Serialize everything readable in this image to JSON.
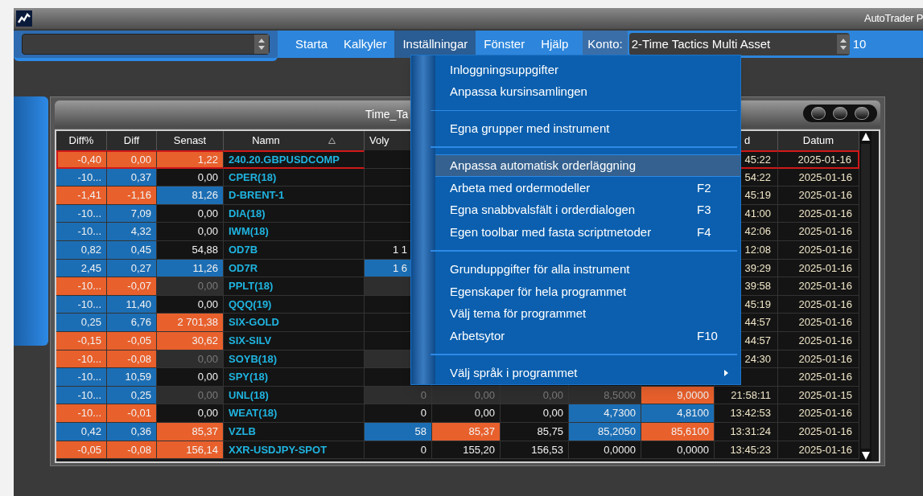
{
  "window": {
    "title": "AutoTrader P"
  },
  "toolbar": {
    "menus": [
      {
        "label": "Starta",
        "selected": false
      },
      {
        "label": "Kalkyler",
        "selected": false
      },
      {
        "label": "Inställningar",
        "selected": true
      },
      {
        "label": "Fönster",
        "selected": false
      },
      {
        "label": "Hjälp",
        "selected": false
      }
    ],
    "account_label": "Konto:",
    "account_value": "2-Time Tactics Multi Asset",
    "column_3": "10"
  },
  "panel": {
    "title": "Time_Ta",
    "table": {
      "columns": [
        {
          "label": "Diff%"
        },
        {
          "label": "Diff"
        },
        {
          "label": "Senast"
        },
        {
          "label": "Namn",
          "sorted": true
        },
        {
          "label": "Voly"
        },
        null,
        null,
        null,
        null,
        {
          "label": "d"
        },
        {
          "label": "Datum"
        }
      ],
      "rows": [
        {
          "selected": true,
          "cells": [
            {
              "text": "-0,40",
              "color": "#e8602c"
            },
            {
              "text": "0,00",
              "color": "#e8602c"
            },
            {
              "text": "1,22",
              "color": "#e8602c"
            },
            {
              "text": "240.20.GBPUSDCOMP"
            },
            null,
            null,
            null,
            null,
            null,
            {
              "text": "45:22"
            },
            {
              "text": "2025-01-16"
            }
          ]
        },
        {
          "selected": false,
          "cells": [
            {
              "text": "-10...",
              "color": "#1c6eb4"
            },
            {
              "text": "0,37",
              "color": "#1c6eb4"
            },
            {
              "text": "0,00"
            },
            {
              "text": "CPER(18)"
            },
            null,
            null,
            null,
            null,
            null,
            {
              "text": "54:22"
            },
            {
              "text": "2025-01-16"
            }
          ]
        },
        {
          "selected": false,
          "cells": [
            {
              "text": "-1,41",
              "color": "#e8602c"
            },
            {
              "text": "-1,16",
              "color": "#e8602c"
            },
            {
              "text": "81,26",
              "color": "#1c6eb4"
            },
            {
              "text": "D-BRENT-1"
            },
            null,
            null,
            null,
            null,
            null,
            {
              "text": "45:19"
            },
            {
              "text": "2025-01-16"
            }
          ]
        },
        {
          "selected": false,
          "cells": [
            {
              "text": "-10...",
              "color": "#1c6eb4"
            },
            {
              "text": "7,09",
              "color": "#1c6eb4"
            },
            {
              "text": "0,00"
            },
            {
              "text": "DIA(18)"
            },
            null,
            null,
            null,
            null,
            null,
            {
              "text": "41:00"
            },
            {
              "text": "2025-01-16"
            }
          ]
        },
        {
          "selected": false,
          "cells": [
            {
              "text": "-10...",
              "color": "#1c6eb4"
            },
            {
              "text": "4,32",
              "color": "#1c6eb4"
            },
            {
              "text": "0,00"
            },
            {
              "text": "IWM(18)"
            },
            null,
            null,
            null,
            null,
            null,
            {
              "text": "42:06"
            },
            {
              "text": "2025-01-16"
            }
          ]
        },
        {
          "selected": false,
          "cells": [
            {
              "text": "0,82",
              "color": "#1c6eb4"
            },
            {
              "text": "0,45",
              "color": "#1c6eb4"
            },
            {
              "text": "54,88"
            },
            {
              "text": "OD7B"
            },
            {
              "text": "1 1"
            },
            null,
            null,
            null,
            null,
            {
              "text": "12:08"
            },
            {
              "text": "2025-01-16"
            }
          ]
        },
        {
          "selected": false,
          "cells": [
            {
              "text": "2,45",
              "color": "#1c6eb4"
            },
            {
              "text": "0,27",
              "color": "#1c6eb4"
            },
            {
              "text": "11,26",
              "color": "#1c6eb4"
            },
            {
              "text": "OD7R"
            },
            {
              "text": "1 6",
              "color": "#1c6eb4"
            },
            null,
            null,
            null,
            null,
            {
              "text": "39:29"
            },
            {
              "text": "2025-01-16"
            }
          ]
        },
        {
          "selected": false,
          "cells": [
            {
              "text": "-10...",
              "color": "#e8602c"
            },
            {
              "text": "-0,07",
              "color": "#e8602c"
            },
            {
              "text": "0,00",
              "color": "#2e2e2e"
            },
            {
              "text": "PPLT(18)"
            },
            {
              "color": "#2e2e2e"
            },
            null,
            null,
            null,
            null,
            {
              "text": "39:58"
            },
            {
              "text": "2025-01-16"
            }
          ]
        },
        {
          "selected": false,
          "cells": [
            {
              "text": "-10...",
              "color": "#1c6eb4"
            },
            {
              "text": "11,40",
              "color": "#1c6eb4"
            },
            {
              "text": "0,00"
            },
            {
              "text": "QQQ(19)"
            },
            null,
            null,
            null,
            null,
            null,
            {
              "text": "45:19"
            },
            {
              "text": "2025-01-16"
            }
          ]
        },
        {
          "selected": false,
          "cells": [
            {
              "text": "0,25",
              "color": "#1c6eb4"
            },
            {
              "text": "6,76",
              "color": "#1c6eb4"
            },
            {
              "text": "2 701,38",
              "color": "#e8602c"
            },
            {
              "text": "SIX-GOLD"
            },
            null,
            null,
            null,
            null,
            null,
            {
              "text": "44:57"
            },
            {
              "text": "2025-01-16"
            }
          ]
        },
        {
          "selected": false,
          "cells": [
            {
              "text": "-0,15",
              "color": "#e8602c"
            },
            {
              "text": "-0,05",
              "color": "#e8602c"
            },
            {
              "text": "30,62",
              "color": "#e8602c"
            },
            {
              "text": "SIX-SILV"
            },
            null,
            null,
            null,
            null,
            null,
            {
              "text": "44:57"
            },
            {
              "text": "2025-01-16"
            }
          ]
        },
        {
          "selected": false,
          "cells": [
            {
              "text": "-10...",
              "color": "#e8602c"
            },
            {
              "text": "-0,08",
              "color": "#e8602c"
            },
            {
              "text": "0,00",
              "color": "#2e2e2e"
            },
            {
              "text": "SOYB(18)"
            },
            {
              "color": "#2e2e2e"
            },
            null,
            null,
            null,
            null,
            {
              "text": "24:30"
            },
            {
              "text": "2025-01-16"
            }
          ]
        },
        {
          "selected": false,
          "cells": [
            {
              "text": "-10...",
              "color": "#1c6eb4"
            },
            {
              "text": "10,59",
              "color": "#1c6eb4"
            },
            {
              "text": "0,00"
            },
            {
              "text": "SPY(18)"
            },
            null,
            null,
            null,
            null,
            null,
            null,
            {
              "text": "2025-01-16"
            }
          ]
        },
        {
          "selected": false,
          "cells": [
            {
              "text": "-10...",
              "color": "#1c6eb4"
            },
            {
              "text": "0,25",
              "color": "#1c6eb4"
            },
            {
              "text": "0,00",
              "color": "#2e2e2e"
            },
            {
              "text": "UNL(18)"
            },
            {
              "text": "0",
              "color": "#2e2e2e"
            },
            {
              "text": "0,00",
              "color": "#2e2e2e"
            },
            {
              "text": "0,00",
              "color": "#2e2e2e"
            },
            {
              "text": "8,5000",
              "color": "#2e2e2e"
            },
            {
              "text": "9,0000",
              "color": "#e8602c"
            },
            {
              "text": "21:58:11"
            },
            {
              "text": "2025-01-15"
            }
          ]
        },
        {
          "selected": false,
          "cells": [
            {
              "text": "-10...",
              "color": "#e8602c"
            },
            {
              "text": "-0,01",
              "color": "#e8602c"
            },
            {
              "text": "0,00"
            },
            {
              "text": "WEAT(18)"
            },
            {
              "text": "0"
            },
            {
              "text": "0,00"
            },
            {
              "text": "0,00"
            },
            {
              "text": "4,7300",
              "color": "#1c6eb4"
            },
            {
              "text": "4,8100",
              "color": "#1c6eb4"
            },
            {
              "text": "13:42:53"
            },
            {
              "text": "2025-01-16"
            }
          ]
        },
        {
          "selected": false,
          "cells": [
            {
              "text": "0,42",
              "color": "#1c6eb4"
            },
            {
              "text": "0,36",
              "color": "#1c6eb4"
            },
            {
              "text": "85,37",
              "color": "#e8602c"
            },
            {
              "text": "VZLB"
            },
            {
              "text": "58",
              "color": "#1c6eb4"
            },
            {
              "text": "85,37",
              "color": "#e8602c"
            },
            {
              "text": "85,75"
            },
            {
              "text": "85,2050",
              "color": "#1c6eb4"
            },
            {
              "text": "85,6100",
              "color": "#e8602c"
            },
            {
              "text": "13:31:24"
            },
            {
              "text": "2025-01-16"
            }
          ]
        },
        {
          "selected": false,
          "cells": [
            {
              "text": "-0,05",
              "color": "#e8602c"
            },
            {
              "text": "-0,08",
              "color": "#e8602c"
            },
            {
              "text": "156,14",
              "color": "#e8602c"
            },
            {
              "text": "XXR-USDJPY-SPOT"
            },
            {
              "text": "0"
            },
            {
              "text": "155,20"
            },
            {
              "text": "156,53"
            },
            {
              "text": "0,0000"
            },
            {
              "text": "0,0000"
            },
            {
              "text": "13:45:23"
            },
            {
              "text": "2025-01-16"
            }
          ]
        }
      ]
    }
  },
  "menu": {
    "items": [
      {
        "kind": "item",
        "label": "Inloggningsuppgifter",
        "selected": false
      },
      {
        "kind": "item",
        "label": "Anpassa kursinsamlingen",
        "selected": false
      },
      {
        "kind": "separator"
      },
      {
        "kind": "item",
        "label": "Egna grupper med instrument",
        "selected": false
      },
      {
        "kind": "separator"
      },
      {
        "kind": "item",
        "label": "Anpassa automatisk orderläggning",
        "selected": true
      },
      {
        "kind": "item",
        "label": "Arbeta med ordermodeller",
        "shortcut": "F2",
        "selected": false
      },
      {
        "kind": "item",
        "label": "Egna snabbvalsfält i orderdialogen",
        "shortcut": "F3",
        "selected": false
      },
      {
        "kind": "item",
        "label": "Egen toolbar med fasta scriptmetoder",
        "shortcut": "F4",
        "selected": false
      },
      {
        "kind": "separator"
      },
      {
        "kind": "item",
        "label": "Grunduppgifter för alla instrument",
        "selected": false
      },
      {
        "kind": "item",
        "label": "Egenskaper för hela programmet",
        "selected": false
      },
      {
        "kind": "item",
        "label": "Välj tema för programmet",
        "selected": false
      },
      {
        "kind": "item",
        "label": "Arbetsytor",
        "shortcut": "F10",
        "selected": false
      },
      {
        "kind": "separator"
      },
      {
        "kind": "submenu",
        "label": "Välj språk i programmet",
        "selected": false
      }
    ]
  }
}
